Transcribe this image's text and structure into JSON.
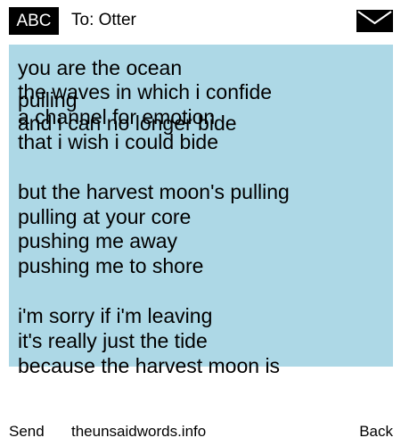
{
  "header": {
    "input_mode": "ABC",
    "recipient": "To: Otter",
    "envelope_icon": "envelope-icon"
  },
  "message": {
    "background": "#add8e6",
    "lines": [
      "you are the ocean",
      "the waves in which i confide",
      "pulling",
      "a channel for emotion",
      "and i can no longer bide",
      "that i wish i could bide",
      "but the harvest moon's pulling",
      "pulling at your core",
      "pushing me away",
      "pushing me to shore",
      "i'm sorry if i'm leaving",
      "it's really just the tide",
      "because the harvest moon is"
    ]
  },
  "footer": {
    "send_label": "Send",
    "site_label": "theunsaidwords.info",
    "back_label": "Back"
  }
}
